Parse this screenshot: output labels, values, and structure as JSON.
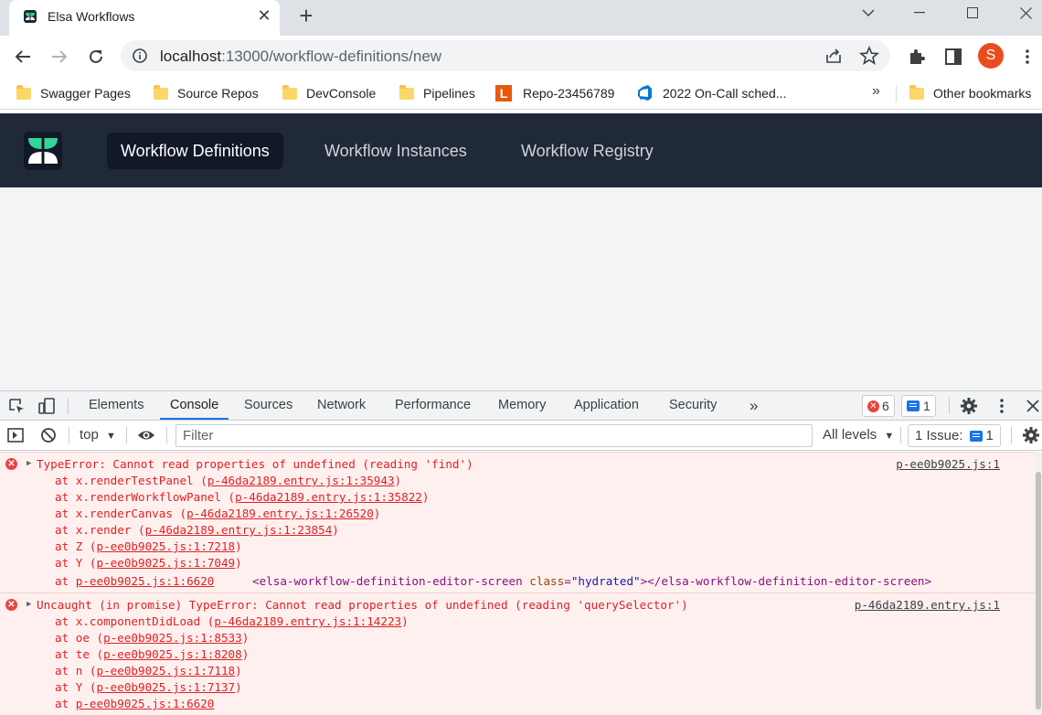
{
  "browser": {
    "tab_title": "Elsa Workflows",
    "url_host": "localhost",
    "url_rest": ":13000/workflow-definitions/new",
    "profile_initial": "S",
    "bookmarks": [
      {
        "label": "Swagger Pages",
        "icon": "folder-icon"
      },
      {
        "label": "Source Repos",
        "icon": "folder-icon"
      },
      {
        "label": "DevConsole",
        "icon": "folder-icon"
      },
      {
        "label": "Pipelines",
        "icon": "folder-icon"
      },
      {
        "label": "Repo-23456789",
        "icon": "l-logo-icon",
        "icon_letter": "L"
      },
      {
        "label": "2022 On-Call sched...",
        "icon": "azure-devops-icon"
      }
    ],
    "bookmarks_overflow": "»",
    "other_bookmarks": "Other bookmarks"
  },
  "app": {
    "nav": [
      {
        "label": "Workflow Definitions",
        "active": true
      },
      {
        "label": "Workflow Instances",
        "active": false
      },
      {
        "label": "Workflow Registry",
        "active": false
      }
    ],
    "colors": {
      "header_bg": "#1f2937",
      "body_bg": "#f3f4f6",
      "logo_green": "#34d399"
    }
  },
  "devtools": {
    "tabs": [
      "Elements",
      "Console",
      "Sources",
      "Network",
      "Performance",
      "Memory",
      "Application",
      "Security"
    ],
    "active_tab": "Console",
    "more_tabs": "»",
    "error_count": "6",
    "message_count": "1",
    "context": "top",
    "filter_placeholder": "Filter",
    "levels": "All levels",
    "issues_label": "1 Issue:",
    "issues_count": "1",
    "errors": [
      {
        "message": "TypeError: Cannot read properties of undefined (reading 'find')",
        "source": "p-ee0b9025.js:1",
        "stack": [
          {
            "prefix": "at x.renderTestPanel (",
            "link": "p-46da2189.entry.js:1:35943",
            "suffix": ")"
          },
          {
            "prefix": "at x.renderWorkflowPanel (",
            "link": "p-46da2189.entry.js:1:35822",
            "suffix": ")"
          },
          {
            "prefix": "at x.renderCanvas (",
            "link": "p-46da2189.entry.js:1:26520",
            "suffix": ")"
          },
          {
            "prefix": "at x.render (",
            "link": "p-46da2189.entry.js:1:23854",
            "suffix": ")"
          },
          {
            "prefix": "at Z (",
            "link": "p-ee0b9025.js:1:7218",
            "suffix": ")"
          },
          {
            "prefix": "at Y (",
            "link": "p-ee0b9025.js:1:7049",
            "suffix": ")"
          },
          {
            "prefix": "at ",
            "link": "p-ee0b9025.js:1:6620",
            "suffix": ""
          }
        ],
        "element": {
          "open_tag": "<elsa-workflow-definition-editor-screen",
          "attr_name": "class",
          "attr_value": "\"hydrated\"",
          "close": "></elsa-workflow-definition-editor-screen>"
        }
      },
      {
        "message": "Uncaught (in promise) TypeError: Cannot read properties of undefined (reading 'querySelector')",
        "source": "p-46da2189.entry.js:1",
        "stack": [
          {
            "prefix": "at x.componentDidLoad (",
            "link": "p-46da2189.entry.js:1:14223",
            "suffix": ")"
          },
          {
            "prefix": "at oe (",
            "link": "p-ee0b9025.js:1:8533",
            "suffix": ")"
          },
          {
            "prefix": "at te (",
            "link": "p-ee0b9025.js:1:8208",
            "suffix": ")"
          },
          {
            "prefix": "at n (",
            "link": "p-ee0b9025.js:1:7118",
            "suffix": ")"
          },
          {
            "prefix": "at Y (",
            "link": "p-ee0b9025.js:1:7137",
            "suffix": ")"
          },
          {
            "prefix": "at ",
            "link": "p-ee0b9025.js:1:6620",
            "suffix": ""
          }
        ]
      }
    ]
  }
}
